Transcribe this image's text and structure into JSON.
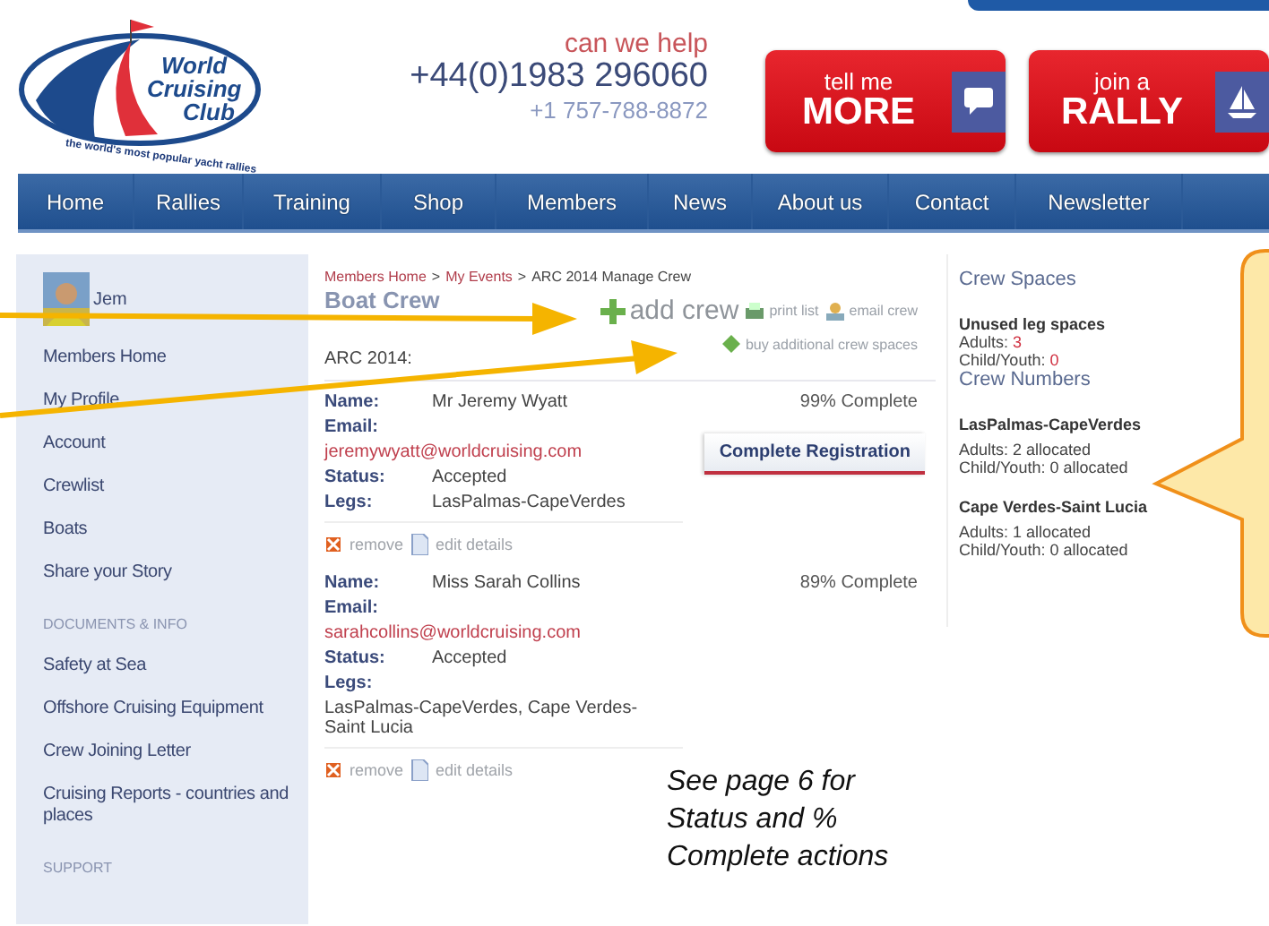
{
  "header": {
    "logo": {
      "lines": [
        "World",
        "Cruising",
        "Club"
      ],
      "slogan": "the world's most popular yacht rallies"
    },
    "tagline": "can we help",
    "phone_uk": "+44(0)1983 296060",
    "phone_us": "+1 757-788-8872",
    "promos": [
      {
        "small": "tell me",
        "big": "MORE",
        "kind": "chat"
      },
      {
        "small": "join a",
        "big": "RALLY",
        "kind": "boat"
      }
    ]
  },
  "nav": [
    "Home",
    "Rallies",
    "Training",
    "Shop",
    "Members",
    "News",
    "About us",
    "Contact",
    "Newsletter"
  ],
  "sidebar": {
    "user": "Jem",
    "items": [
      {
        "kind": "link",
        "label": "Members Home"
      },
      {
        "kind": "link",
        "label": "My Profile"
      },
      {
        "kind": "link",
        "label": "Account"
      },
      {
        "kind": "link",
        "label": "Crewlist"
      },
      {
        "kind": "link",
        "label": "Boats"
      },
      {
        "kind": "link",
        "label": "Share your Story"
      },
      {
        "kind": "heading",
        "label": "DOCUMENTS & INFO"
      },
      {
        "kind": "link",
        "label": "Safety at Sea"
      },
      {
        "kind": "link",
        "label": "Offshore Cruising Equipment"
      },
      {
        "kind": "link",
        "label": "Crew Joining Letter"
      },
      {
        "kind": "link",
        "label": "Cruising Reports - countries and places"
      },
      {
        "kind": "heading",
        "label": "SUPPORT"
      }
    ]
  },
  "breadcrumb": [
    {
      "label": "Members Home",
      "link": true
    },
    {
      "label": "My Events",
      "link": true
    },
    {
      "label": "ARC 2014 Manage Crew",
      "link": false
    }
  ],
  "breadcrumb_separator": ">",
  "title": "Boat Crew",
  "event": "ARC 2014:",
  "actions": [
    {
      "kind": "add",
      "label": "add crew"
    },
    {
      "kind": "print",
      "label": "print list"
    },
    {
      "kind": "email",
      "label": "email crew"
    },
    {
      "kind": "buy",
      "label": "buy additional crew spaces"
    }
  ],
  "crew": [
    {
      "complete": "99% Complete",
      "action": "Complete Registration",
      "fields": [
        {
          "kind": "inline",
          "label": "Name:",
          "value": "Mr Jeremy Wyatt"
        },
        {
          "kind": "email",
          "label": "Email:",
          "value": "jeremywyatt@worldcruising.com"
        },
        {
          "kind": "inline",
          "label": "Status:",
          "value": "Accepted"
        },
        {
          "kind": "inline",
          "label": "Legs:",
          "value": "LasPalmas-CapeVerdes"
        }
      ],
      "remove": "remove",
      "edit": "edit details"
    },
    {
      "complete": "89% Complete",
      "fields": [
        {
          "kind": "inline",
          "label": "Name:",
          "value": "Miss Sarah Collins"
        },
        {
          "kind": "email",
          "label": "Email:",
          "value": "sarahcollins@worldcruising.com"
        },
        {
          "kind": "inline",
          "label": "Status:",
          "value": "Accepted"
        },
        {
          "kind": "below",
          "label": "Legs:",
          "value": "LasPalmas-CapeVerdes, Cape Verdes-Saint Lucia"
        }
      ],
      "remove": "remove",
      "edit": "edit details"
    }
  ],
  "note": [
    "See page 6 for",
    "Status and %",
    "Complete actions"
  ],
  "spaces": {
    "title": "Crew Spaces",
    "unused_heading": "Unused leg spaces",
    "unused": [
      {
        "label": "Adults:",
        "value": "3"
      },
      {
        "label": "Child/Youth:",
        "value": "0"
      }
    ],
    "numbers_title": "Crew Numbers",
    "legs": [
      {
        "name": "LasPalmas-CapeVerdes",
        "lines": [
          "Adults: 2 allocated",
          "Child/Youth: 0 allocated"
        ]
      },
      {
        "name": "Cape Verdes-Saint Lucia",
        "lines": [
          "Adults: 1 allocated",
          "Child/Youth: 0 allocated"
        ]
      }
    ]
  }
}
